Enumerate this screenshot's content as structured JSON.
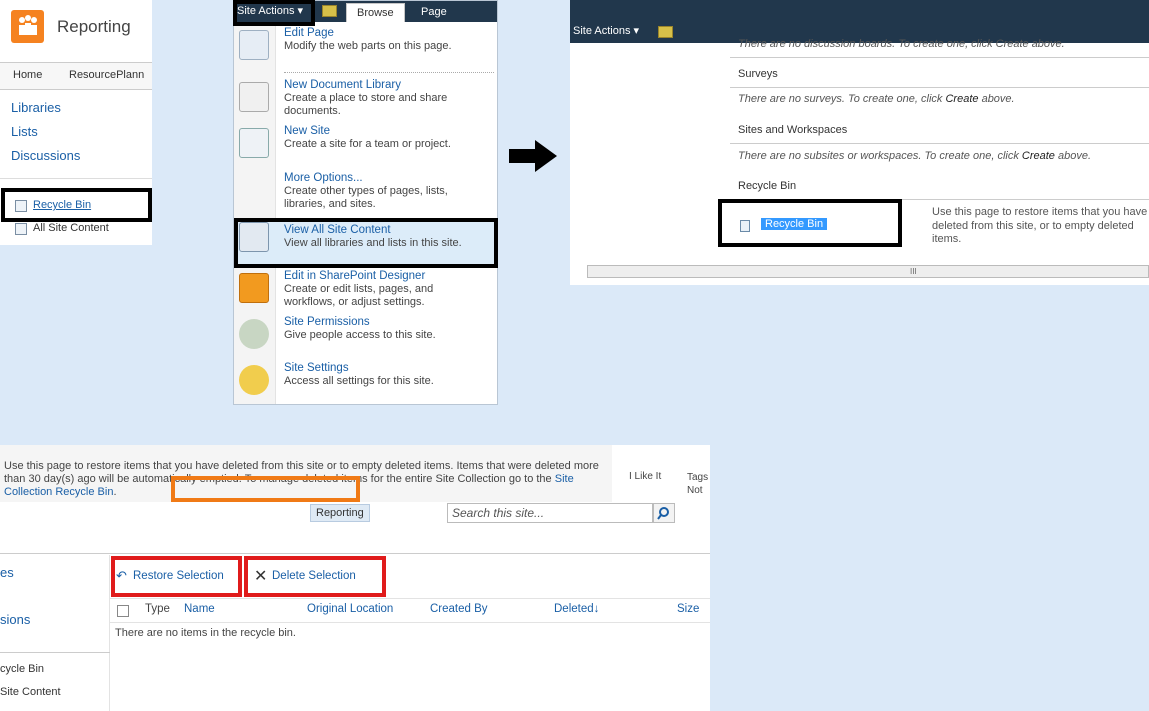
{
  "panel_nav": {
    "site_title": "Reporting",
    "top_nav": [
      "Home",
      "ResourcePlann"
    ],
    "quick_launch": [
      "Libraries",
      "Lists",
      "Discussions"
    ],
    "recycle_bin": "Recycle Bin",
    "all_site_content": "All Site Content"
  },
  "panel_menu": {
    "site_actions": "Site Actions ▾",
    "tabs": [
      "Browse",
      "Page"
    ],
    "items": [
      {
        "title": "Edit Page",
        "desc": "Modify the web parts on this page.",
        "icon": "edit-page-icon"
      },
      {
        "title": "New Document Library",
        "desc": "Create a place to store and share documents.",
        "icon": "document-library-icon"
      },
      {
        "title": "New Site",
        "desc": "Create a site for a team or project.",
        "icon": "new-site-icon"
      },
      {
        "title": "More Options...",
        "desc": "Create other types of pages, lists, libraries, and sites.",
        "icon": "more-options-icon"
      },
      {
        "title": "View All Site Content",
        "desc": "View all libraries and lists in this site.",
        "icon": "site-content-icon"
      },
      {
        "title": "Edit in SharePoint Designer",
        "desc": "Create or edit lists, pages, and workflows, or adjust settings.",
        "icon": "sharepoint-designer-icon"
      },
      {
        "title": "Site Permissions",
        "desc": "Give people access to this site.",
        "icon": "permissions-icon"
      },
      {
        "title": "Site Settings",
        "desc": "Access all settings for this site.",
        "icon": "settings-gear-icon"
      }
    ]
  },
  "panel_content": {
    "site_actions": "Site Actions ▾",
    "clipped_line": "There are no discussion boards. To create one, click Create above.",
    "surveys_heading": "Surveys",
    "surveys_empty_pre": "There are no surveys. To create one, click ",
    "surveys_empty_link": "Create",
    "surveys_empty_post": " above.",
    "sites_heading": "Sites and Workspaces",
    "sites_empty_pre": "There are no subsites or workspaces. To create one, click ",
    "sites_empty_link": "Create",
    "sites_empty_post": " above.",
    "recycle_heading": "Recycle Bin",
    "recycle_link": "Recycle Bin",
    "recycle_desc": "Use this page to restore items that you have deleted from this site, or to empty deleted items.",
    "scroll_thumb": "III"
  },
  "panel_recycle": {
    "info_text": "Use this page to restore items that you have deleted from this site or to empty deleted items. Items that were deleted more than 30 day(s) ago will be automatically emptied. To manage deleted items for the entire Site Collection go to the ",
    "info_link": "Site Collection Recycle Bin",
    "info_end": ".",
    "i_like_it": "I Like It",
    "tags": "Tags",
    "notes": "Not",
    "reporting_tab": "Reporting",
    "search_placeholder": "Search this site...",
    "left_links": [
      "es",
      "sions"
    ],
    "left_static": [
      "cycle Bin",
      "Site Content"
    ],
    "restore_label": "Restore Selection",
    "delete_label": "Delete Selection",
    "columns": [
      "Type",
      "Name",
      "Original Location",
      "Created By",
      "Deleted↓",
      "Size"
    ],
    "empty_message": "There are no items in the recycle bin."
  },
  "colors": {
    "ribbon_dark": "#21374c",
    "link_blue": "#1a5fa6",
    "highlight_black": "#000000",
    "highlight_red": "#e01b1b",
    "highlight_orange": "#f07a16",
    "logo_orange": "#f58220"
  }
}
